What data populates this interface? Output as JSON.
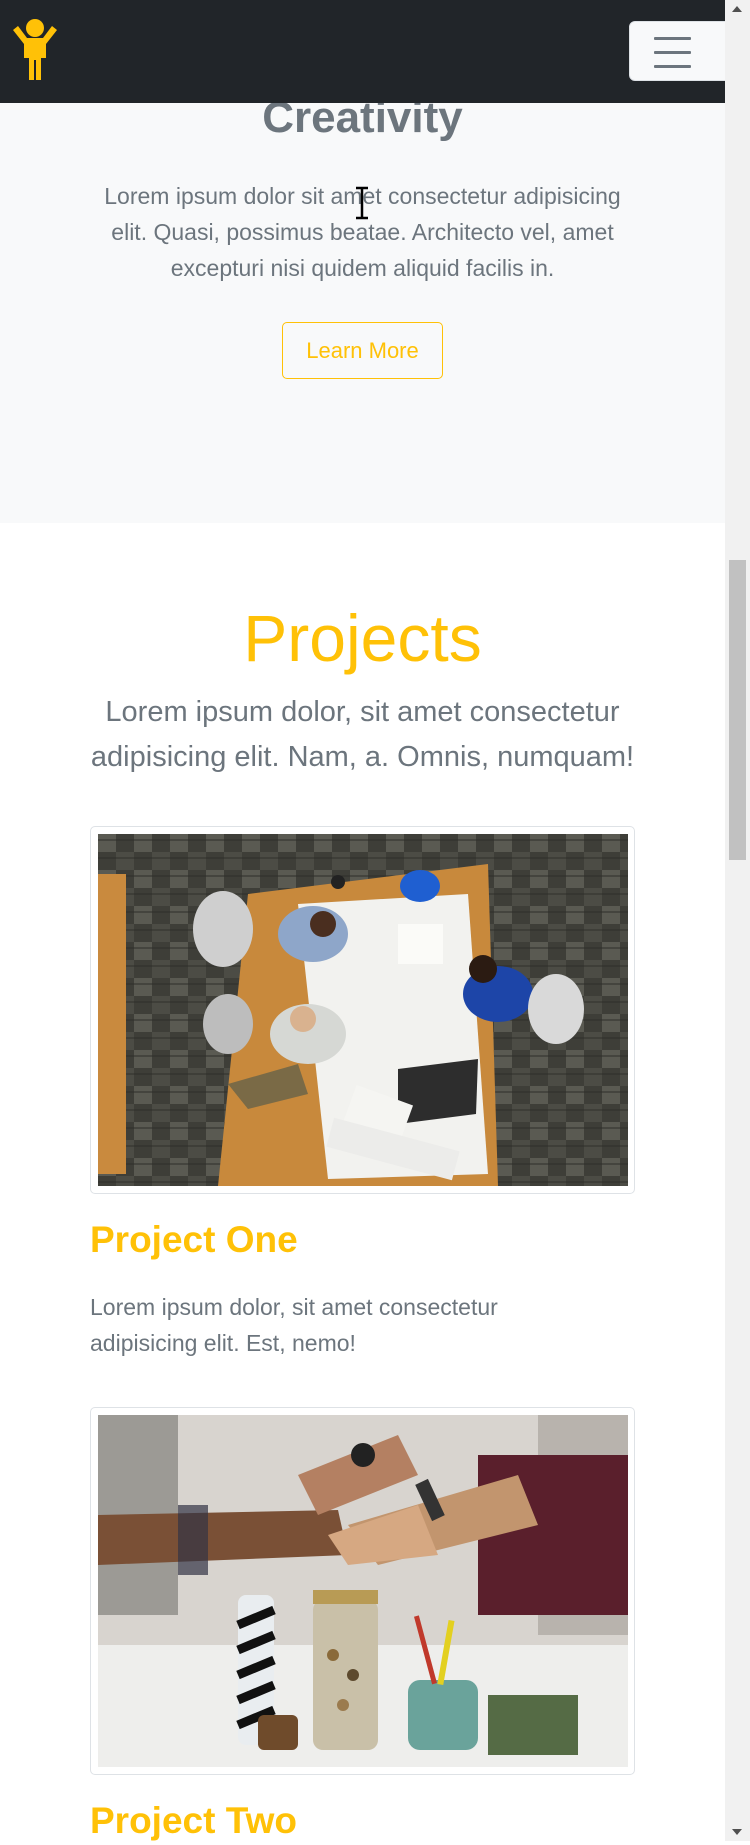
{
  "navbar": {
    "logo_icon": "child-person-icon",
    "toggler_icon": "hamburger-menu-icon",
    "accent": "#ffc107",
    "background": "#212529"
  },
  "creativity": {
    "title": "Creativity",
    "text": "Lorem ipsum dolor sit amet consectetur adipisicing elit. Quasi, possimus beatae. Architecto vel, amet excepturi nisi quidem aliquid facilis in.",
    "button_label": "Learn More"
  },
  "projects": {
    "title": "Projects",
    "lead": "Lorem ipsum dolor, sit amet consectetur adipisicing elit. Nam, a. Omnis, numquam!",
    "items": [
      {
        "title": "Project One",
        "text": "Lorem ipsum dolor, sit amet consectetur adipisicing elit. Est, nemo!",
        "image": "team-meeting-photo"
      },
      {
        "title": "Project Two",
        "image": "team-fist-bump-photo"
      }
    ]
  },
  "colors": {
    "accent": "#ffc107",
    "muted_text": "#6c757d",
    "light_bg": "#f8f9fa"
  }
}
